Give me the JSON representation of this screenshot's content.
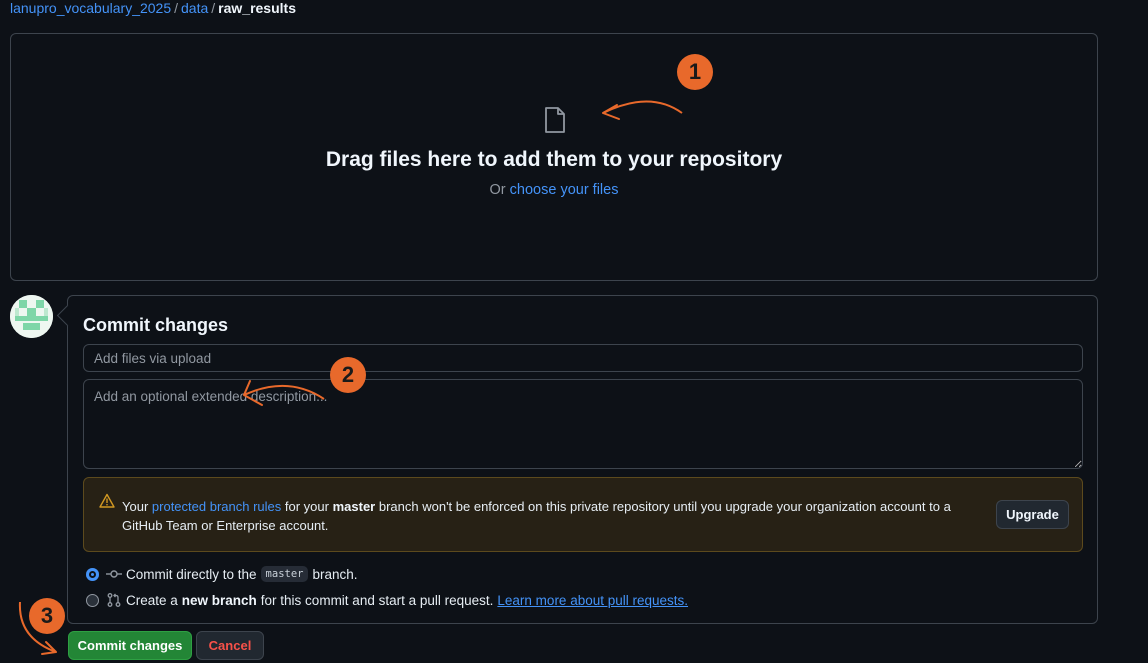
{
  "breadcrumb": {
    "repo": "lanupro_vocabulary_2025",
    "folder": "data",
    "current": "raw_results",
    "separator": "/"
  },
  "dropzone": {
    "title": "Drag files here to add them to your repository",
    "or_text": "Or",
    "choose_link": "choose your files"
  },
  "commit": {
    "title": "Commit changes",
    "summary_placeholder": "Add files via upload",
    "description_placeholder": "Add an optional extended description..."
  },
  "warning": {
    "text_before": "Your",
    "link": "protected branch rules",
    "text_for": "for your",
    "branch": "master",
    "text_after": "branch won't be enforced on this private repository until you upgrade your organization account to a GitHub Team or Enterprise account.",
    "upgrade_button": "Upgrade"
  },
  "options": {
    "direct_prefix": "Commit directly to the",
    "direct_branch": "master",
    "direct_suffix": "branch.",
    "new_prefix": "Create a",
    "new_bold": "new branch",
    "new_suffix": "for this commit and start a pull request.",
    "learn_more": "Learn more about pull requests."
  },
  "buttons": {
    "commit": "Commit changes",
    "cancel": "Cancel"
  },
  "annotations": {
    "badge1": "1",
    "badge2": "2",
    "badge3": "3"
  },
  "colors": {
    "background": "#0d1117",
    "link": "#4493f8",
    "commit_button": "#238636",
    "cancel_text": "#f85149",
    "annotation": "#e8692b",
    "warning_bg": "#272115"
  },
  "icons": {
    "file": "file-icon",
    "warning": "alert-icon",
    "commit": "git-commit-icon",
    "pull_request": "git-pull-request-icon",
    "avatar": "identicon-avatar"
  }
}
